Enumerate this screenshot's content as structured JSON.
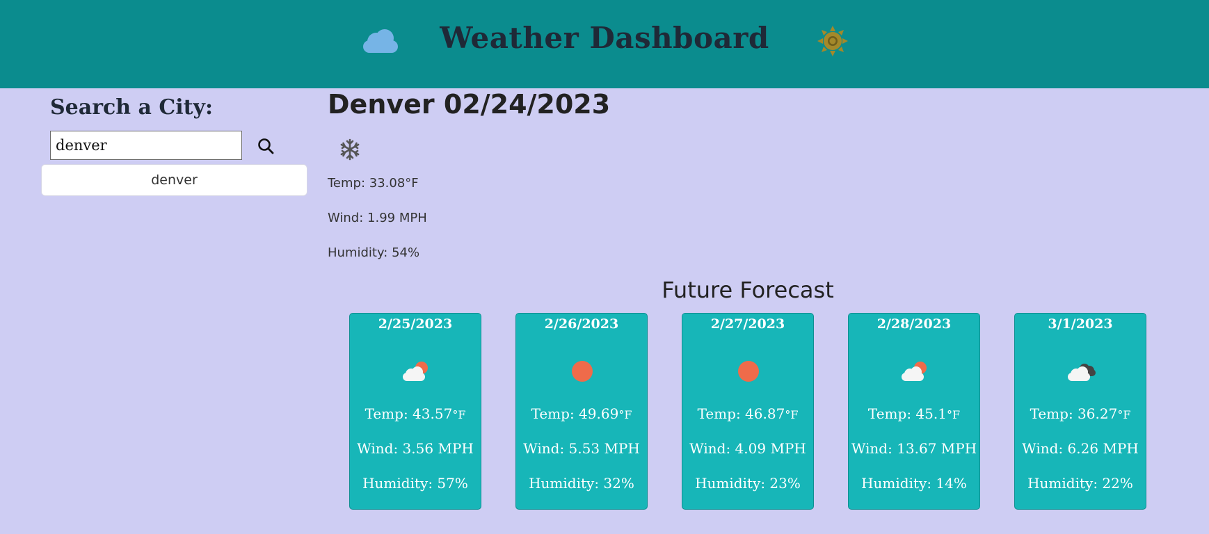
{
  "header": {
    "title": "Weather Dashboard",
    "left_icon": "cloud-icon",
    "right_icon": "sun-icon",
    "background": "#0b8c8e"
  },
  "sidebar": {
    "heading": "Search a City:",
    "search_value": "denver",
    "search_icon": "search-icon",
    "history": [
      "denver"
    ]
  },
  "current": {
    "title": "Denver 02/24/2023",
    "icon": "snowflake-icon",
    "temp": "Temp: 33.08°F",
    "wind": "Wind: 1.99 MPH",
    "humidity": "Humidity: 54%"
  },
  "forecast": {
    "heading": "Future Forecast",
    "card_color": "#17b6b8",
    "days": [
      {
        "date": "2/25/2023",
        "icon": "partly-cloudy-day-icon",
        "temp": "Temp: 43.57",
        "wind": "Wind: 3.56 MPH",
        "humidity": "Humidity: 57%"
      },
      {
        "date": "2/26/2023",
        "icon": "clear-sun-icon",
        "temp": "Temp: 49.69",
        "wind": "Wind: 5.53 MPH",
        "humidity": "Humidity: 32%"
      },
      {
        "date": "2/27/2023",
        "icon": "clear-sun-icon",
        "temp": "Temp: 46.87",
        "wind": "Wind: 4.09 MPH",
        "humidity": "Humidity: 23%"
      },
      {
        "date": "2/28/2023",
        "icon": "partly-cloudy-day-icon",
        "temp": "Temp: 45.1",
        "wind": "Wind: 13.67 MPH",
        "humidity": "Humidity: 14%"
      },
      {
        "date": "3/1/2023",
        "icon": "broken-clouds-icon",
        "temp": "Temp: 36.27",
        "wind": "Wind: 6.26 MPH",
        "humidity": "Humidity: 22%"
      }
    ],
    "temp_unit": "°F"
  }
}
